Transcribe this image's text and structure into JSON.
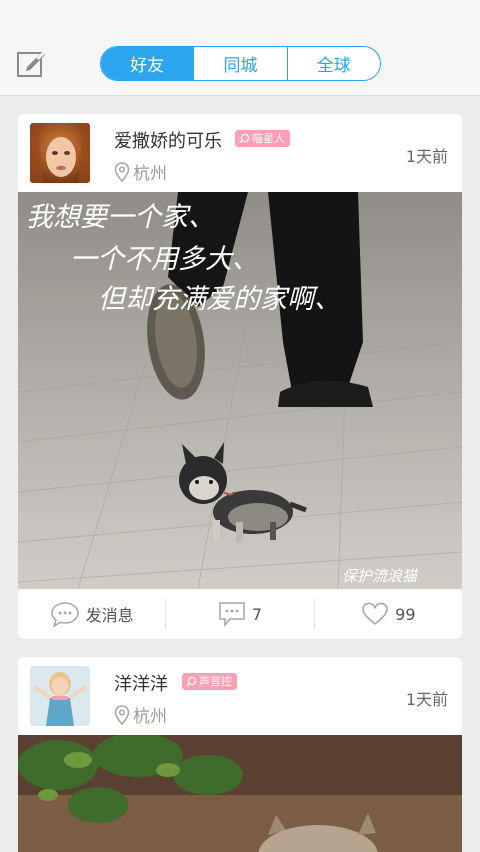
{
  "tabs": [
    {
      "label": "好友",
      "active": true
    },
    {
      "label": "同城",
      "active": false
    },
    {
      "label": "全球",
      "active": false
    }
  ],
  "icons": {
    "compose": "compose-icon",
    "location": "location-pin-icon",
    "message": "chat-bubble-icon",
    "comment": "comment-icon",
    "like": "heart-icon",
    "badge": "search-bubble-icon"
  },
  "colors": {
    "accent": "#2aa5ee",
    "badge": "#ff9fb2"
  },
  "posts": [
    {
      "username": "爱撒娇的可乐",
      "badge": "喵星人",
      "location": "杭州",
      "time": "1天前",
      "photo_caption_lines": [
        "我想要一个家、",
        "一个不用多大、",
        "但却充满爱的家啊、"
      ],
      "photo_watermark": "保护流浪猫",
      "message_label": "发消息",
      "comment_count": "7",
      "like_count": "99"
    },
    {
      "username": "洋洋洋",
      "badge": "声音控",
      "location": "杭州",
      "time": "1天前"
    }
  ]
}
